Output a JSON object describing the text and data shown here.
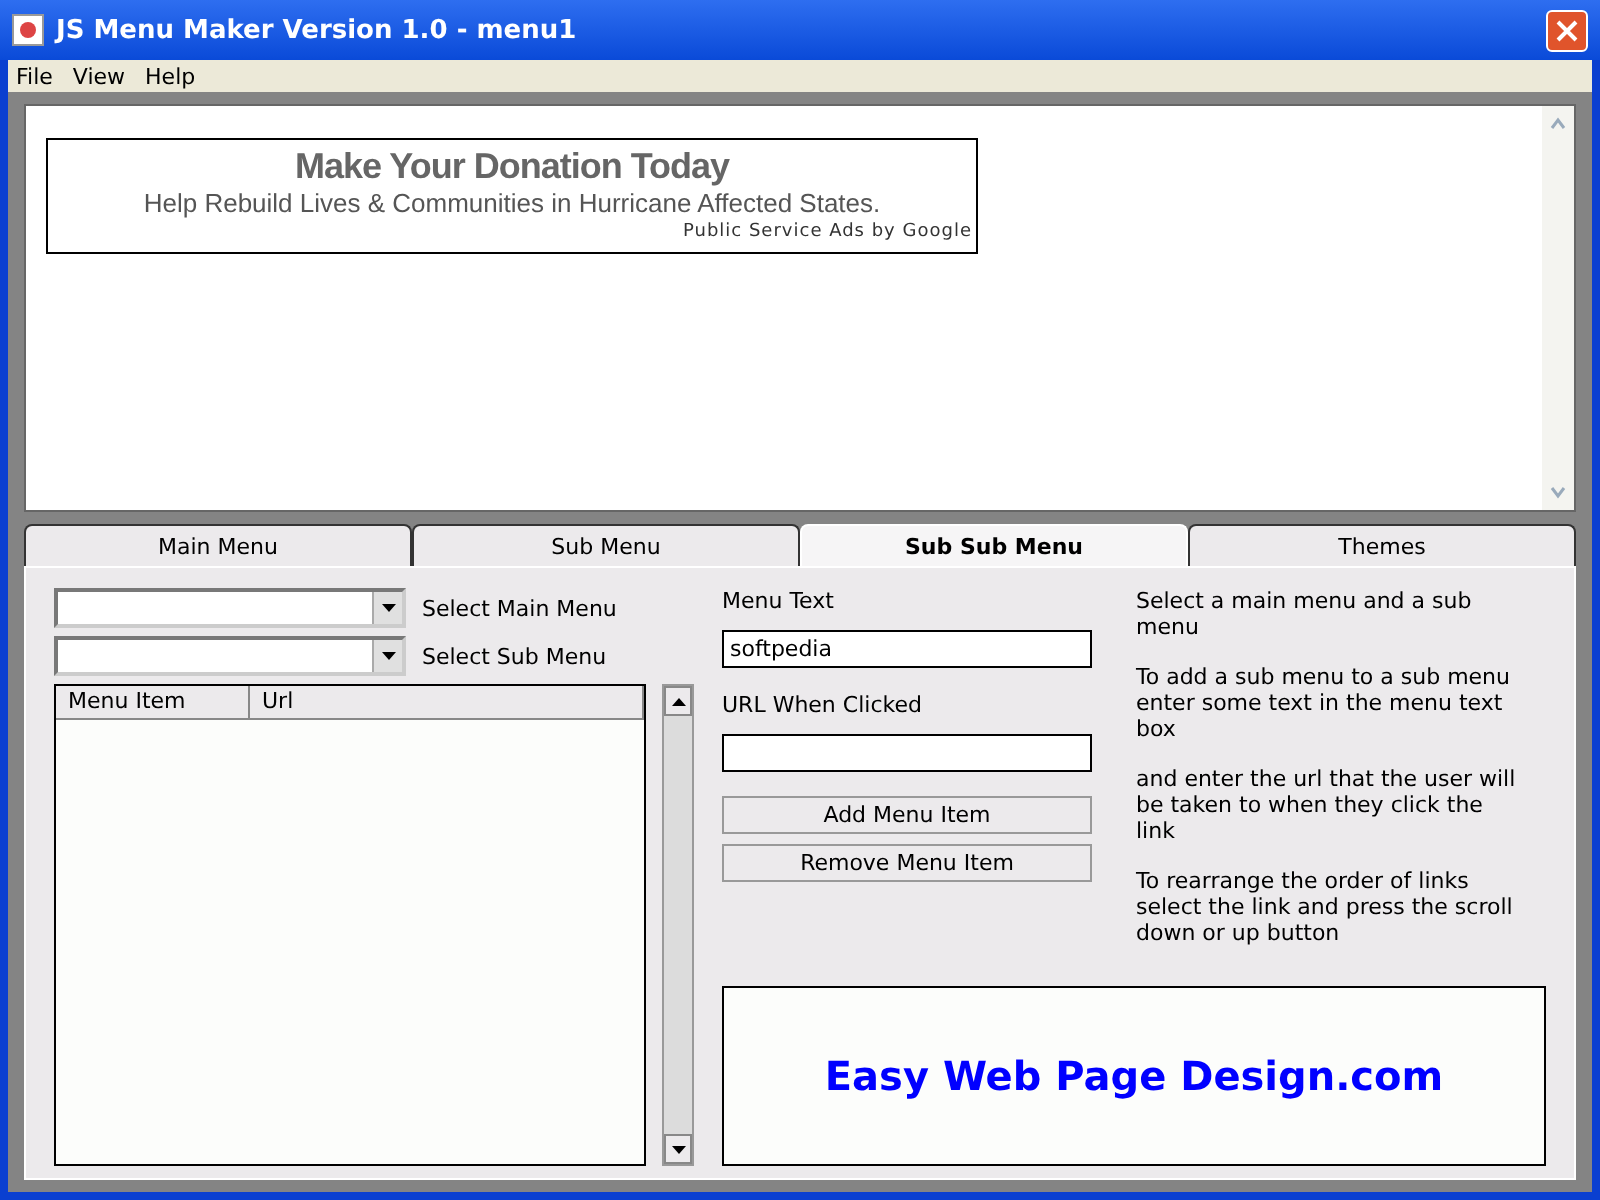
{
  "window": {
    "title": "JS Menu Maker Version 1.0 - menu1"
  },
  "menu_bar": [
    "File",
    "View",
    "Help"
  ],
  "ad": {
    "headline": "Make Your Donation Today",
    "text": "Help Rebuild Lives & Communities in Hurricane Affected States.",
    "attribution": "Public Service Ads by Google"
  },
  "tabs": [
    {
      "label": "Main Menu",
      "selected": false
    },
    {
      "label": "Sub Menu",
      "selected": false
    },
    {
      "label": "Sub Sub Menu",
      "selected": true
    },
    {
      "label": "Themes",
      "selected": false
    }
  ],
  "form": {
    "select_main_menu": {
      "label": "Select Main Menu"
    },
    "select_sub_menu": {
      "label": "Select Sub Menu"
    },
    "table": {
      "columns": [
        "Menu Item",
        "Url"
      ]
    },
    "menu_text": {
      "label": "Menu Text",
      "value": "softpedia"
    },
    "url": {
      "label": "URL When Clicked"
    },
    "buttons": [
      "Add Menu Item",
      "Remove Menu Item"
    ]
  },
  "instructions": [
    "Select a main menu and a sub menu",
    "To add a sub menu to a sub menu enter some text in the menu text box",
    "and enter the url that the user will be taken to when they click the link",
    "To rearrange the order of links select the link and press the scroll down or up button"
  ],
  "banner": "Easy Web Page Design.com"
}
